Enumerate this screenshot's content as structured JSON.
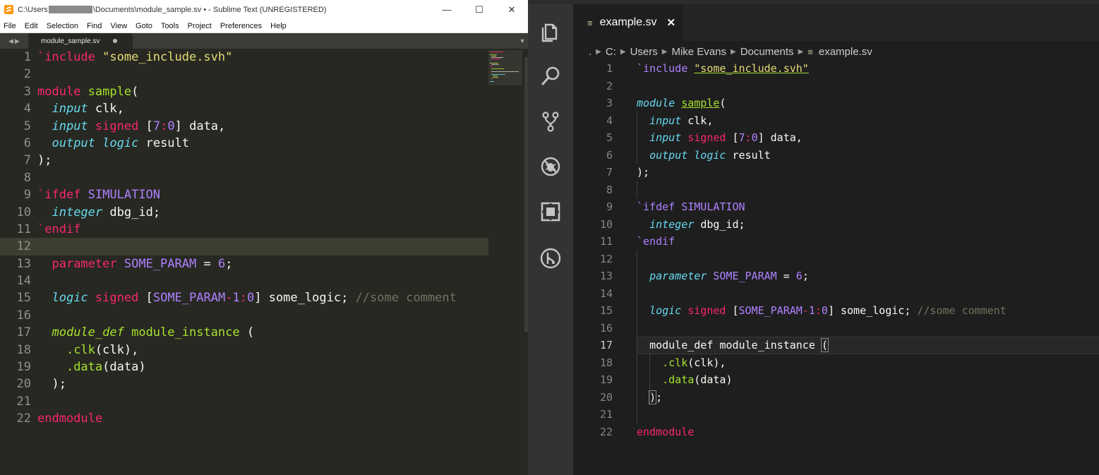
{
  "sublime": {
    "title_prefix": "C:\\Users",
    "title_suffix": "\\Documents\\module_sample.sv • - Sublime Text (UNREGISTERED)",
    "menu": [
      "File",
      "Edit",
      "Selection",
      "Find",
      "View",
      "Goto",
      "Tools",
      "Project",
      "Preferences",
      "Help"
    ],
    "tab_label": "module_sample.sv",
    "window_controls": {
      "minimize": "—",
      "maximize": "☐",
      "close": "✕"
    }
  },
  "vscode": {
    "tab_label": "example.sv",
    "tab_close": "✕",
    "breadcrumb": [
      ".",
      "C:",
      "Users",
      "Mike Evans",
      "Documents",
      "example.sv"
    ]
  },
  "code": {
    "line_numbers": [
      "1",
      "2",
      "3",
      "4",
      "5",
      "6",
      "7",
      "8",
      "9",
      "10",
      "11",
      "12",
      "13",
      "14",
      "15",
      "16",
      "17",
      "18",
      "19",
      "20",
      "21",
      "22"
    ],
    "lines": [
      "`include \"some_include.svh\"",
      "",
      "module sample(",
      "  input clk,",
      "  input signed [7:0] data,",
      "  output logic result",
      ");",
      "",
      "`ifdef SIMULATION",
      "  integer dbg_id;",
      "`endif",
      "",
      "  parameter SOME_PARAM = 6;",
      "",
      "  logic signed [SOME_PARAM-1:0] some_logic; //some comment",
      "",
      "  module_def module_instance (",
      "    .clk(clk),",
      "    .data(data)",
      "  );",
      "",
      "endmodule"
    ]
  },
  "colors": {
    "keyword": "#f92672",
    "type": "#66d9ef",
    "function": "#a6e22e",
    "string": "#e6db74",
    "number": "#ae81ff",
    "comment": "#75715e"
  },
  "icons": {
    "explorer": "files-icon",
    "search": "search-icon",
    "source_control": "source-control-icon",
    "debug": "debug-icon",
    "extensions": "extensions-icon",
    "remote": "remote-icon"
  }
}
